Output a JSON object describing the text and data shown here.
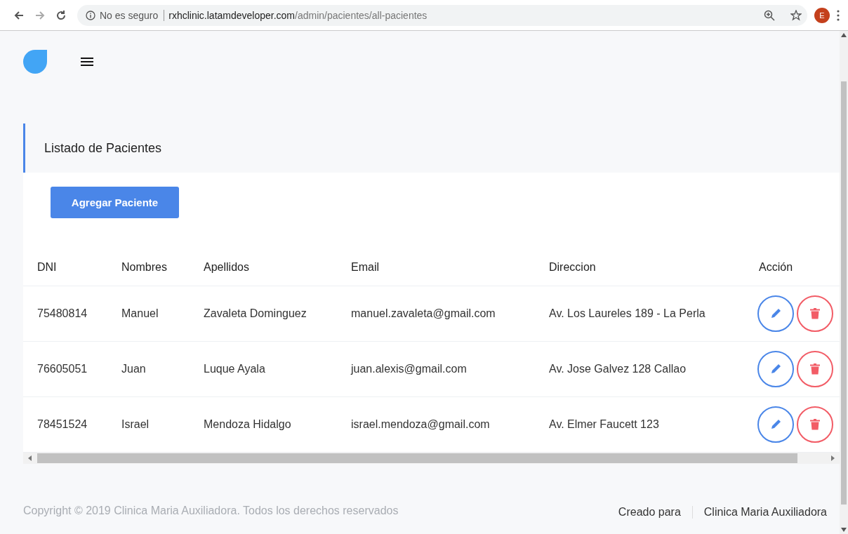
{
  "browser": {
    "security": "No es seguro",
    "url_host": "rxhclinic.latamdeveloper.com",
    "url_path": "/admin/pacientes/all-pacientes",
    "profile": "E"
  },
  "card": {
    "title": "Listado de Pacientes",
    "add_button": "Agregar Paciente"
  },
  "table": {
    "columns": [
      "DNI",
      "Nombres",
      "Apellidos",
      "Email",
      "Direccion",
      "Acción"
    ],
    "rows": [
      {
        "dni": "75480814",
        "nombres": "Manuel",
        "apellidos": "Zavaleta Dominguez",
        "email": "manuel.zavaleta@gmail.com",
        "direccion": "Av. Los Laureles 189 - La Perla"
      },
      {
        "dni": "76605051",
        "nombres": "Juan",
        "apellidos": "Luque Ayala",
        "email": "juan.alexis@gmail.com",
        "direccion": "Av. Jose Galvez 128 Callao"
      },
      {
        "dni": "78451524",
        "nombres": "Israel",
        "apellidos": "Mendoza Hidalgo",
        "email": "israel.mendoza@gmail.com",
        "direccion": "Av. Elmer Faucett 123"
      }
    ]
  },
  "footer": {
    "copyright": "Copyright © 2019 Clinica Maria Auxiliadora. Todos los derechos reservados",
    "created_label": "Creado para",
    "created_for": "Clinica Maria Auxiliadora"
  }
}
